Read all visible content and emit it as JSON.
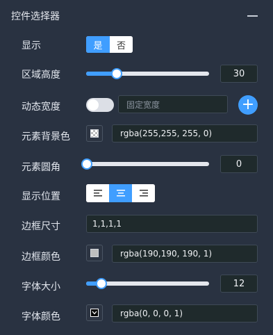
{
  "panel": {
    "title": "控件选择器",
    "collapse_icon": "minus-icon"
  },
  "rows": {
    "display": {
      "label": "显示",
      "options": [
        "是",
        "否"
      ],
      "selected": "是"
    },
    "region_height": {
      "label": "区域高度",
      "slider_fraction": 0.25,
      "value": "30"
    },
    "dynamic_width": {
      "label": "动态宽度",
      "toggle_on": false,
      "placeholder": "固定宽度",
      "add_icon": "plus-icon"
    },
    "bg_color": {
      "label": "元素背景色",
      "value": "rgba(255,255, 255, 0)",
      "swatch_icon": "transparent-checker-icon"
    },
    "radius": {
      "label": "元素圆角",
      "slider_fraction": 0.0,
      "value": "0"
    },
    "position": {
      "label": "显示位置",
      "options": [
        "align-left-icon",
        "align-center-icon",
        "align-right-icon"
      ],
      "selected_index": 1
    },
    "border_size": {
      "label": "边框尺寸",
      "value": "1,1,1,1"
    },
    "border_color": {
      "label": "边框颜色",
      "value": "rgba(190,190, 190, 1)",
      "swatch_color": "#bebebe"
    },
    "font_size": {
      "label": "字体大小",
      "slider_fraction": 0.12,
      "value": "12"
    },
    "font_color": {
      "label": "字体颜色",
      "value": "rgba(0, 0, 0, 1)",
      "swatch_color": "#000000"
    }
  },
  "colors": {
    "accent": "#409eff",
    "background": "#293241"
  }
}
